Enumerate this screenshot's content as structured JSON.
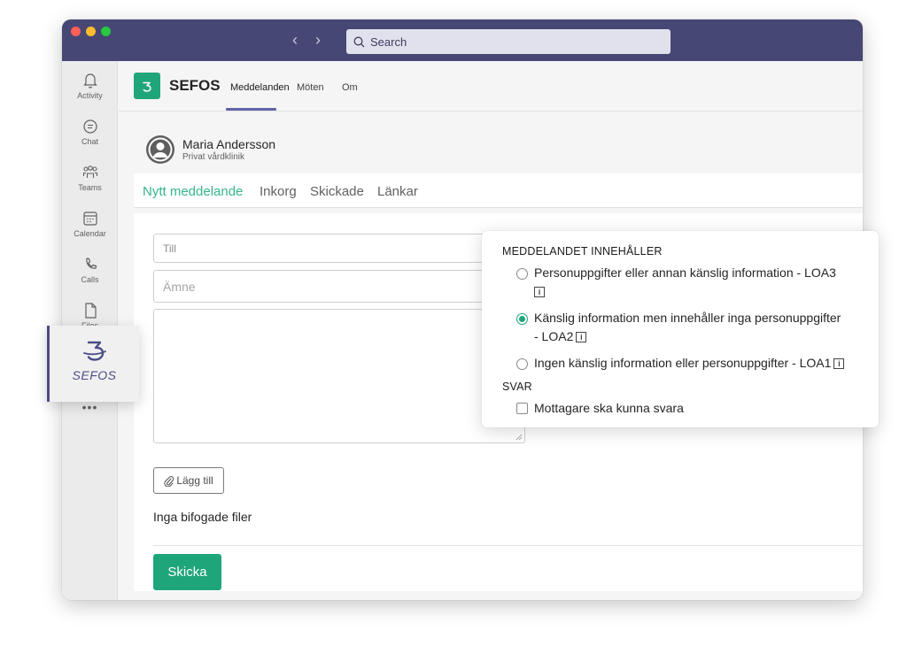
{
  "search": {
    "placeholder": "Search"
  },
  "rail": {
    "items": [
      {
        "label": "Activity",
        "icon": "bell-icon"
      },
      {
        "label": "Chat",
        "icon": "chat-icon"
      },
      {
        "label": "Teams",
        "icon": "teams-icon"
      },
      {
        "label": "Calendar",
        "icon": "calendar-icon"
      },
      {
        "label": "Calls",
        "icon": "phone-icon"
      },
      {
        "label": "Files",
        "icon": "file-icon"
      }
    ],
    "app": {
      "label": "SEFOS",
      "icon": "sefos-logo-icon"
    },
    "more": "•••"
  },
  "app": {
    "name": "SEFOS",
    "tabs": [
      "Meddelanden",
      "Möten",
      "Om"
    ],
    "active_tab": "Meddelanden"
  },
  "user": {
    "name": "Maria Andersson",
    "org": "Privat vårdklinik"
  },
  "subtabs": {
    "items": [
      "Nytt meddelande",
      "Inkorg",
      "Skickade",
      "Länkar"
    ],
    "active": "Nytt meddelande"
  },
  "form": {
    "to_placeholder": "Till",
    "subject_placeholder": "Ämne",
    "attach_label": "Lägg till",
    "no_files": "Inga bifogade filer",
    "send_label": "Skicka"
  },
  "popover": {
    "heading": "MEDDELANDET INNEHÅLLER",
    "options": [
      {
        "line1": "Personuppgifter eller annan känslig information - LOA3",
        "line2": "",
        "checked": false
      },
      {
        "line1": "Känslig information men innehåller inga personuppgifter",
        "line2": "- LOA2",
        "checked": true
      },
      {
        "line1": "Ingen känslig information eller personuppgifter - LOA1",
        "line2": "",
        "checked": false
      }
    ],
    "reply_heading": "SVAR",
    "reply_option": "Mottagare ska kunna svara",
    "reply_checked": false,
    "info_glyph": "i"
  },
  "colors": {
    "brand_green": "#1fa57a",
    "teams_purple": "#464775",
    "accent_purple": "#6264a7",
    "active_tab_green": "#37b58a"
  }
}
